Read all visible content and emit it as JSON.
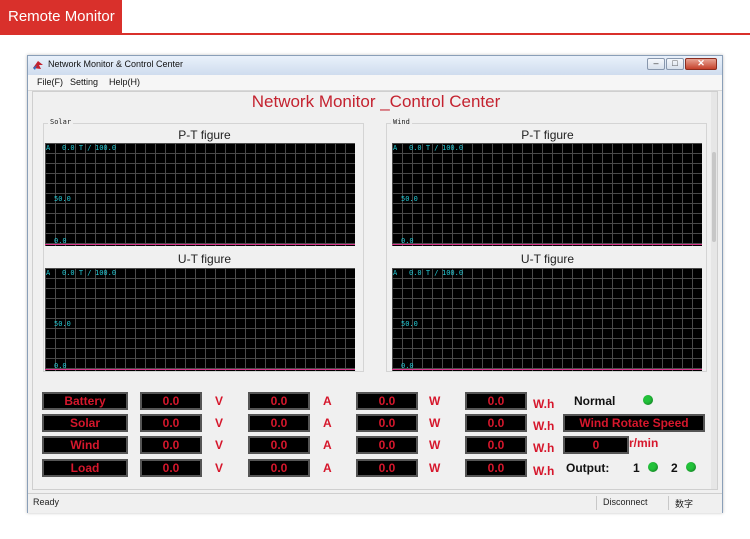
{
  "banner": {
    "title": "Remote Monitor"
  },
  "window": {
    "title": "Network Monitor & Control Center",
    "buttons": {
      "minimize": "–",
      "maximize": "□",
      "close": "✕"
    }
  },
  "menu": {
    "file": "File(F)",
    "setting": "Setting",
    "help": "Help(H)"
  },
  "main_title": "Network Monitor _Control Center",
  "panels": {
    "solar": {
      "label": "Solar"
    },
    "wind": {
      "label": "Wind"
    }
  },
  "figures": {
    "pt_title": "P-T figure",
    "ut_title": "U-T figure",
    "axis": {
      "unit": "A",
      "time_label": "0.0 T /",
      "y_max": "100.0",
      "y_mid": "50.0",
      "y_min": "0.0"
    }
  },
  "readings": {
    "rows": [
      {
        "name": "Battery",
        "voltage": "0.0",
        "current": "0.0",
        "power": "0.0",
        "energy": "0.0"
      },
      {
        "name": "Solar",
        "voltage": "0.0",
        "current": "0.0",
        "power": "0.0",
        "energy": "0.0"
      },
      {
        "name": "Wind",
        "voltage": "0.0",
        "current": "0.0",
        "power": "0.0",
        "energy": "0.0"
      },
      {
        "name": "Load",
        "voltage": "0.0",
        "current": "0.0",
        "power": "0.0",
        "energy": "0.0"
      }
    ],
    "units": {
      "voltage": "V",
      "current": "A",
      "power": "W",
      "energy": "W.h"
    }
  },
  "status_panel": {
    "normal": "Normal",
    "wind_speed_label": "Wind Rotate Speed",
    "wind_speed_value": "0",
    "wind_speed_unit": "r/min",
    "output_label": "Output:",
    "output_1": "1",
    "output_2": "2",
    "led_color": "#22c23a"
  },
  "statusbar": {
    "left": "Ready",
    "connection": "Disconnect",
    "mode": "数字"
  }
}
